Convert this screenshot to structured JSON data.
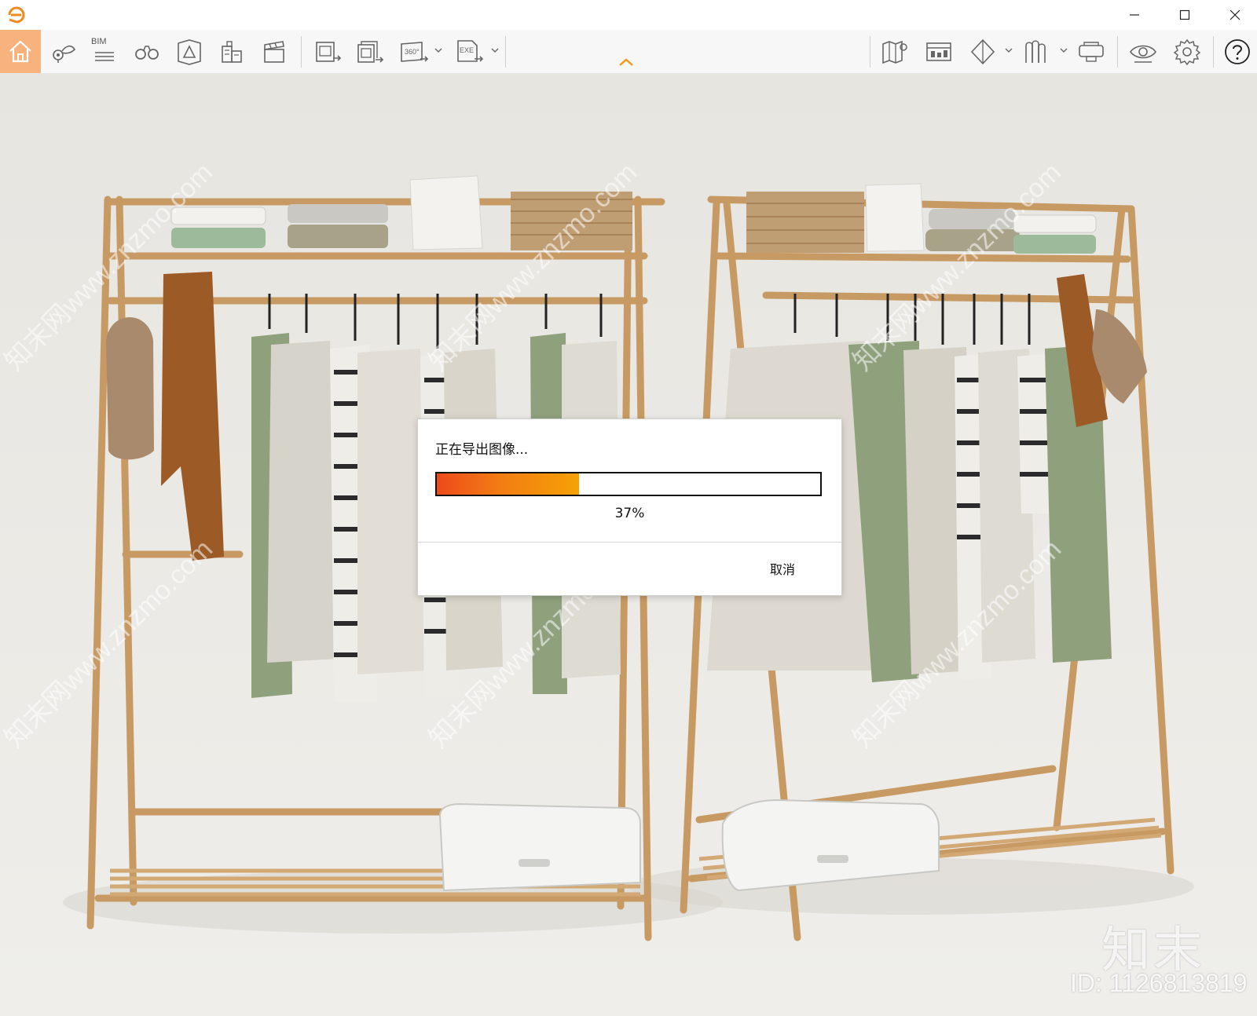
{
  "toolbar": {
    "bim_label": "BIM",
    "icons": [
      "home-icon",
      "location-pin-icon",
      "bim-icon",
      "binoculars-icon",
      "perspective-icon",
      "buildings-icon",
      "clapper-icon",
      "export-image-icon",
      "export-batch-icon",
      "export-360-icon",
      "export-exe-icon",
      "map-icon",
      "panel-icon",
      "cube-icon",
      "cabinet-icon",
      "vr-headset-icon",
      "eye-icon",
      "gear-icon",
      "help-icon"
    ],
    "export_360_label": "360°",
    "export_exe_label": "EXE"
  },
  "dialog": {
    "title": "正在导出图像...",
    "progress": 0.37,
    "progress_text": "37%",
    "cancel_label": "取消"
  },
  "watermark": {
    "brand": "知末",
    "id": "ID: 1126813819",
    "site_text": "知末网www.znzmo.com"
  },
  "colors": {
    "accent": "#f39a1a",
    "home_active": "#f8b27e",
    "progress_start": "#ee4a1c",
    "progress_end": "#f5a106"
  }
}
